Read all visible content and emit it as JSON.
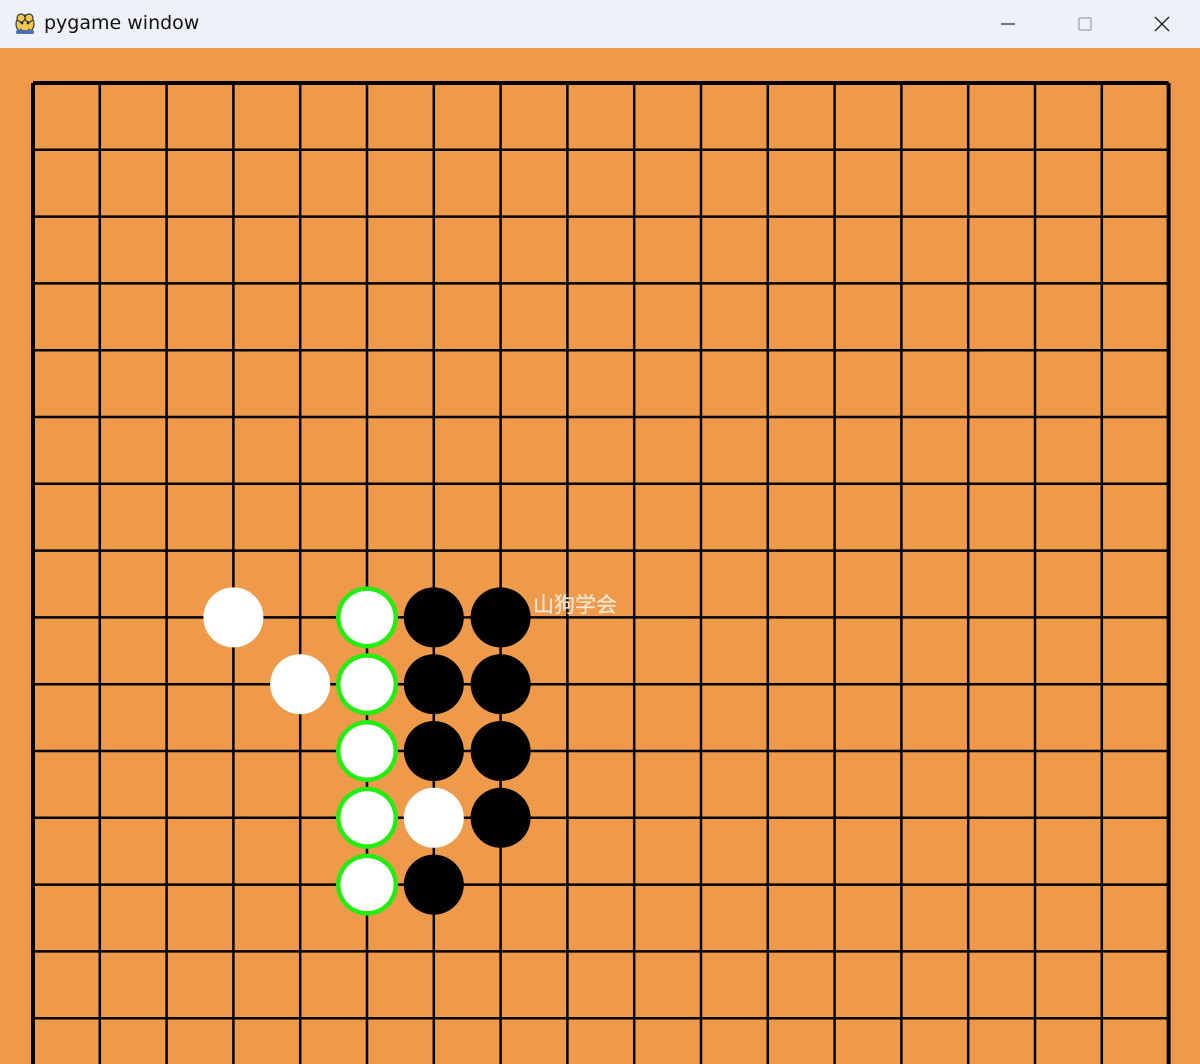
{
  "window": {
    "title": "pygame window",
    "icon": "pygame-snake-icon",
    "controls": [
      "minimize-icon",
      "maximize-icon",
      "close-icon"
    ]
  },
  "colors": {
    "titlebar": "#eef2f8",
    "board": "#ee9a4a",
    "grid_line": "#000000",
    "black_stone": "#000000",
    "white_stone": "#ffffff",
    "highlight_ring": "#22ee11",
    "watermark_text": "#f4e6d6"
  },
  "game": {
    "board_size": 19,
    "visible_rows": 16,
    "watermark": "山狗学会",
    "stones": [
      {
        "col": 3,
        "row": 8,
        "color": "white",
        "highlight": false
      },
      {
        "col": 4,
        "row": 9,
        "color": "white",
        "highlight": false
      },
      {
        "col": 5,
        "row": 8,
        "color": "white",
        "highlight": true
      },
      {
        "col": 5,
        "row": 9,
        "color": "white",
        "highlight": true
      },
      {
        "col": 5,
        "row": 10,
        "color": "white",
        "highlight": true
      },
      {
        "col": 5,
        "row": 11,
        "color": "white",
        "highlight": true
      },
      {
        "col": 5,
        "row": 12,
        "color": "white",
        "highlight": true
      },
      {
        "col": 6,
        "row": 11,
        "color": "white",
        "highlight": false
      },
      {
        "col": 6,
        "row": 8,
        "color": "black",
        "highlight": false
      },
      {
        "col": 6,
        "row": 9,
        "color": "black",
        "highlight": false
      },
      {
        "col": 6,
        "row": 10,
        "color": "black",
        "highlight": false
      },
      {
        "col": 6,
        "row": 12,
        "color": "black",
        "highlight": false
      },
      {
        "col": 7,
        "row": 8,
        "color": "black",
        "highlight": false
      },
      {
        "col": 7,
        "row": 9,
        "color": "black",
        "highlight": false
      },
      {
        "col": 7,
        "row": 10,
        "color": "black",
        "highlight": false
      },
      {
        "col": 7,
        "row": 11,
        "color": "black",
        "highlight": false
      }
    ]
  }
}
